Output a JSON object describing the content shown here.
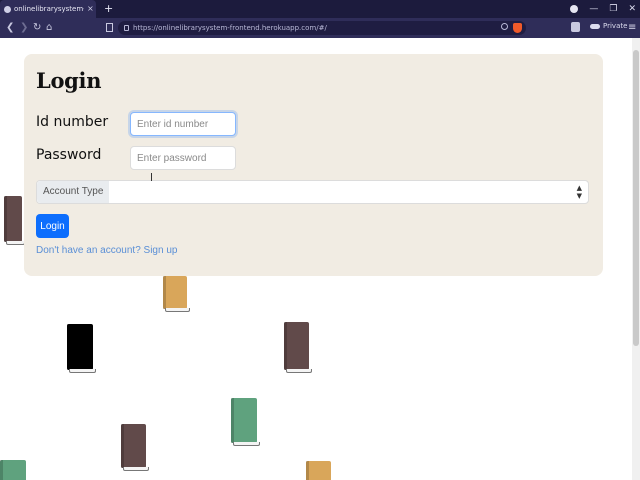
{
  "browser": {
    "tab_title": "onlinelibrarysystem-frontend",
    "new_tab": "+",
    "url": "https://onlinelibrarysystem-frontend.herokuapp.com/#/",
    "private_label": "Private"
  },
  "login": {
    "title": "Login",
    "id_label": "Id number",
    "id_placeholder": "Enter id number",
    "password_label": "Password",
    "password_placeholder": "Enter password",
    "account_type_label": "Account Type",
    "login_button": "Login",
    "signup_link": "Don't have an account? Sign up"
  },
  "colors": {
    "card_background": "#f1ece3",
    "primary_button": "#0d6efd",
    "link": "#5a8fd6",
    "book_brown": "#614a4a",
    "book_tan": "#d9a65a",
    "book_black": "#000000",
    "book_green": "#5fa27e"
  }
}
